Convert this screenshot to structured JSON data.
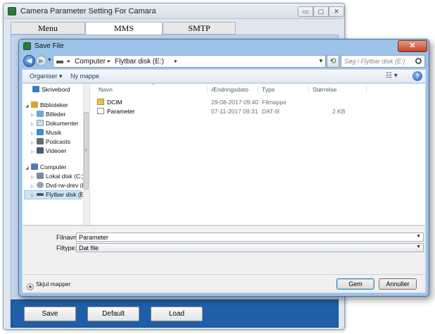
{
  "app": {
    "title": "Camera Parameter Setting For  Camara",
    "tabs": [
      "Menu",
      "MMS",
      "SMTP"
    ],
    "buttons": {
      "save": "Save",
      "default": "Default",
      "load": "Load"
    },
    "window_controls": {
      "minimize": "▭",
      "maximize": "▢",
      "close": "✕"
    }
  },
  "dialog": {
    "title": "Save File",
    "close_glyph": "✕",
    "address": {
      "crumbs": [
        "Computer",
        "Flytbar disk (E:)"
      ],
      "separator": "▸",
      "search_placeholder": "Søg i Flytbar disk (E:)"
    },
    "toolbar": {
      "organise": "Organiser ▾",
      "new_folder": "Ny mappe",
      "view": "☷ ▾",
      "help": "?"
    },
    "nav": {
      "items": [
        {
          "label": "Skrivebord",
          "icon": "desktop-icon",
          "color": "#3b78c4"
        },
        {
          "label": "Biblioteker",
          "icon": "libraries-icon",
          "color": "#d9a23a"
        },
        {
          "label": "Billeder",
          "icon": "pictures-icon",
          "color": "#6aa8d8"
        },
        {
          "label": "Dokumenter",
          "icon": "documents-icon",
          "color": "#cfd8e3"
        },
        {
          "label": "Musik",
          "icon": "music-icon",
          "color": "#3a8fd0"
        },
        {
          "label": "Podcasts",
          "icon": "podcasts-icon",
          "color": "#6a6a6a"
        },
        {
          "label": "Videoer",
          "icon": "videos-icon",
          "color": "#4a5a78"
        },
        {
          "label": "Computer",
          "icon": "computer-icon",
          "color": "#4b7bb5"
        },
        {
          "label": "Lokal disk (C:)",
          "icon": "local-disk-icon",
          "color": "#7a8a9a"
        },
        {
          "label": "Dvd-rw-drev (D:)",
          "icon": "dvd-drive-icon",
          "color": "#9aa0a8"
        },
        {
          "label": "Flytbar disk (E:)",
          "icon": "removable-disk-icon",
          "color": "#555555"
        }
      ]
    },
    "columns": {
      "name": "Navn",
      "modified": "Ændringsdato",
      "type": "Type",
      "size": "Størrelse"
    },
    "files": [
      {
        "name": "DCIM",
        "modified": "29-08-2017 09:40",
        "type": "Filmappe",
        "size": "",
        "icon": "folder-icon"
      },
      {
        "name": "Parameter",
        "modified": "07-11-2017 09:31",
        "type": "DAT-fil",
        "size": "2 KB",
        "icon": "file-icon"
      }
    ],
    "form": {
      "filename_label": "Filnavn:",
      "filename_value": "Parameter",
      "filetype_label": "Filtype:",
      "filetype_value": "Dat file"
    },
    "hide_folders": "Skjul mapper",
    "buttons": {
      "save": "Gem",
      "cancel": "Annuller"
    }
  }
}
